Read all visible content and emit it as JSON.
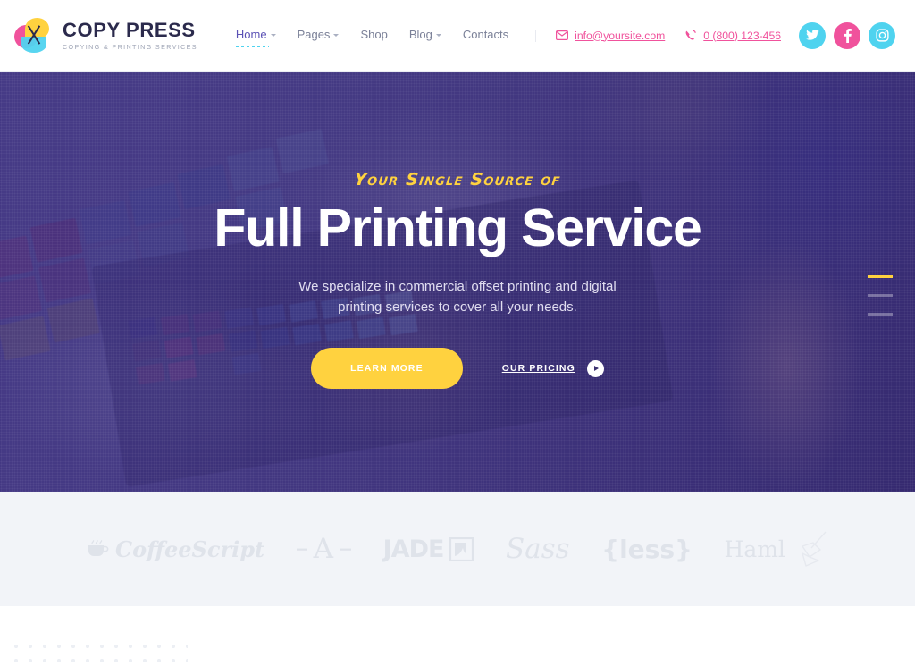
{
  "brand": {
    "name": "COPY PRESS",
    "tagline": "COPYING & PRINTING SERVICES",
    "logo_icon": "copy-press-logo-icon",
    "colors": {
      "pink": "#f0529c",
      "yellow": "#ffd23f",
      "cyan": "#4fd3ef",
      "dark": "#2b2a4c"
    }
  },
  "nav": {
    "items": [
      {
        "label": "Home",
        "has_dropdown": true,
        "active": true
      },
      {
        "label": "Pages",
        "has_dropdown": true,
        "active": false
      },
      {
        "label": "Shop",
        "has_dropdown": false,
        "active": false
      },
      {
        "label": "Blog",
        "has_dropdown": true,
        "active": false
      },
      {
        "label": "Contacts",
        "has_dropdown": false,
        "active": false
      }
    ]
  },
  "contact": {
    "email": "info@yoursite.com",
    "email_icon": "envelope-icon",
    "phone": "0 (800) 123-456",
    "phone_icon": "phone-ring-icon"
  },
  "socials": [
    {
      "name": "twitter",
      "icon": "twitter-icon",
      "color": "#4fd3ef"
    },
    {
      "name": "facebook",
      "icon": "facebook-icon",
      "color": "#f0529c"
    },
    {
      "name": "instagram",
      "icon": "instagram-icon",
      "color": "#4fd3ef"
    }
  ],
  "hero": {
    "kicker": "Your Single Source of",
    "title": "Full Printing Service",
    "subtitle_line1": "We specialize in commercial offset printing and digital",
    "subtitle_line2": "printing services to cover all your needs.",
    "primary_button": "LEARN MORE",
    "secondary_button": "OUR PRICING",
    "secondary_icon": "play-arrow-icon",
    "accent_color": "#ffd23f",
    "overlay_color": "#3e3080",
    "slides": [
      {
        "index": 1,
        "active": true
      },
      {
        "index": 2,
        "active": false
      },
      {
        "index": 3,
        "active": false
      }
    ]
  },
  "partners": [
    {
      "label": "CoffeeScript",
      "icon": "coffee-cup-icon",
      "style": "p-coffee"
    },
    {
      "label": "A",
      "icon": "autoprefixer-icon",
      "style": "p-auto"
    },
    {
      "label": "JADE",
      "icon": "jade-badge-icon",
      "style": "p-jade"
    },
    {
      "label": "Sass",
      "icon": "",
      "style": "p-sass"
    },
    {
      "label": "{less}",
      "icon": "",
      "style": "p-less"
    },
    {
      "label": "Haml",
      "icon": "haml-tool-icon",
      "style": "p-haml"
    }
  ],
  "decoration": {
    "dot_grid": "dot-grid-pattern"
  }
}
